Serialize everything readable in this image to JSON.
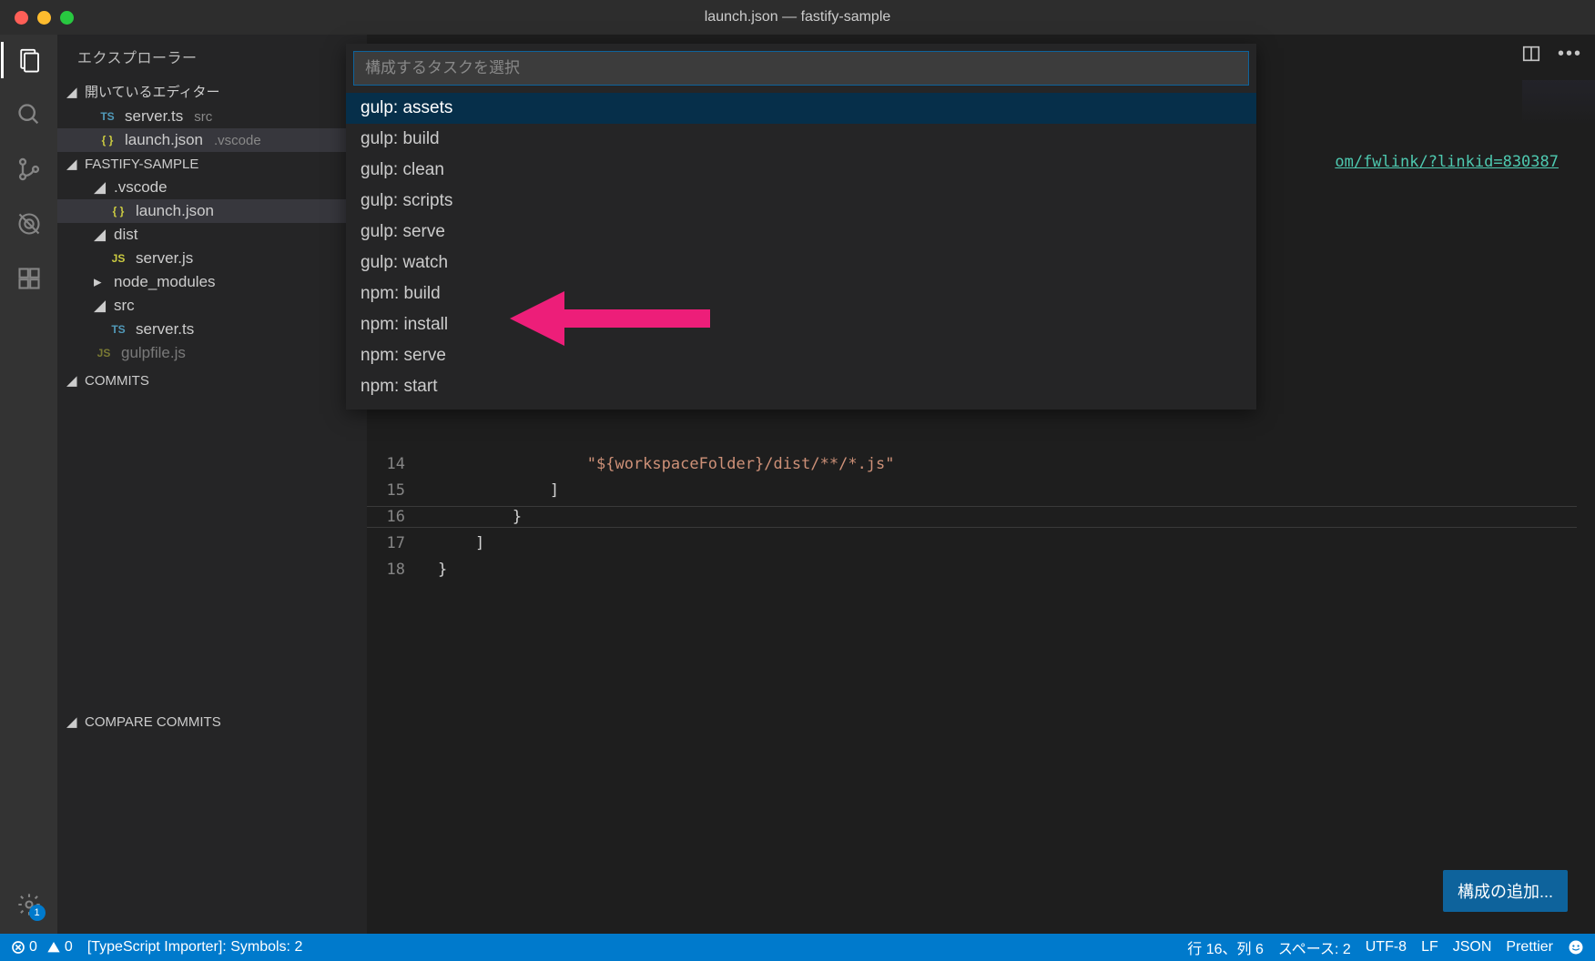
{
  "window": {
    "title": "launch.json — fastify-sample"
  },
  "sidebar": {
    "title": "エクスプローラー",
    "open_editors_header": "開いているエディター",
    "open_editors": [
      {
        "icon": "TS",
        "name": "server.ts",
        "detail": "src"
      },
      {
        "icon": "{ }",
        "name": "launch.json",
        "detail": ".vscode"
      }
    ],
    "project_header": "FASTIFY-SAMPLE",
    "tree": [
      {
        "type": "folder",
        "name": ".vscode",
        "expanded": true,
        "indent": 1
      },
      {
        "type": "file",
        "name": "launch.json",
        "icon": "{ }",
        "indent": 2,
        "active": true
      },
      {
        "type": "folder",
        "name": "dist",
        "expanded": true,
        "indent": 1
      },
      {
        "type": "file",
        "name": "server.js",
        "icon": "JS",
        "indent": 2
      },
      {
        "type": "folder",
        "name": "node_modules",
        "expanded": false,
        "indent": 1
      },
      {
        "type": "folder",
        "name": "src",
        "expanded": true,
        "indent": 1
      },
      {
        "type": "file",
        "name": "server.ts",
        "icon": "TS",
        "indent": 2
      },
      {
        "type": "file",
        "name": "gulpfile.js",
        "icon": "JS",
        "indent": 1,
        "faded": true
      }
    ],
    "commits_header": "COMMITS",
    "compare_commits_header": "COMPARE COMMITS"
  },
  "quick_picker": {
    "placeholder": "構成するタスクを選択",
    "items": [
      "gulp: assets",
      "gulp: build",
      "gulp: clean",
      "gulp: scripts",
      "gulp: serve",
      "gulp: watch",
      "npm: build",
      "npm: install",
      "npm: serve",
      "npm: start"
    ],
    "selected_index": 0
  },
  "editor": {
    "visible_link_fragment": "om/fwlink/?linkid=830387",
    "lines": [
      {
        "num": 14,
        "text": "                \"${workspaceFolder}/dist/**/*.js\"",
        "string": true
      },
      {
        "num": 15,
        "text": "            ]"
      },
      {
        "num": 16,
        "text": "        }",
        "current": true
      },
      {
        "num": 17,
        "text": "    ]"
      },
      {
        "num": 18,
        "text": "}"
      }
    ],
    "config_button": "構成の追加..."
  },
  "status": {
    "errors": "0",
    "warnings": "0",
    "ts_importer": "[TypeScript Importer]: Symbols: 2",
    "cursor": "行 16、列 6",
    "spaces": "スペース: 2",
    "encoding": "UTF-8",
    "eol": "LF",
    "language": "JSON",
    "prettier": "Prettier"
  },
  "activity": {
    "settings_badge": "1"
  }
}
